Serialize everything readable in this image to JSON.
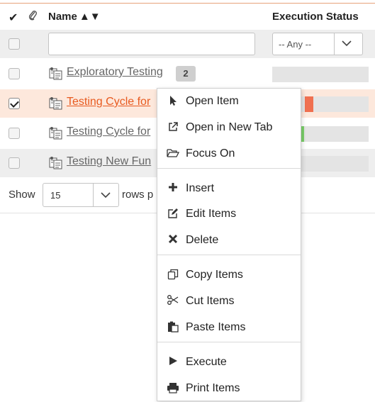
{
  "grid": {
    "columns": {
      "check_icon": "✔",
      "attachment_icon": "✎",
      "name": "Name",
      "sort_icon": "▲▼",
      "status": "Execution Status"
    },
    "filter": {
      "name_value": "",
      "status_value": "-- Any --"
    },
    "rows": [
      {
        "name": "Exploratory Testing",
        "badge": "2",
        "checked": false
      },
      {
        "name": "Testing Cycle for",
        "checked": true
      },
      {
        "name": "Testing Cycle for",
        "checked": false
      },
      {
        "name": "Testing New Fun",
        "checked": false
      }
    ]
  },
  "pager": {
    "show_label": "Show",
    "rows_value": "15",
    "suffix": "rows p"
  },
  "context_menu": {
    "items": [
      {
        "label": "Open Item",
        "icon": "cursor-arrow-icon"
      },
      {
        "label": "Open in New Tab",
        "icon": "external-link-icon"
      },
      {
        "label": "Focus On",
        "icon": "folder-open-icon"
      },
      {
        "label": "Insert",
        "icon": "plus-icon"
      },
      {
        "label": "Edit Items",
        "icon": "edit-icon"
      },
      {
        "label": "Delete",
        "icon": "delete-x-icon"
      },
      {
        "label": "Copy Items",
        "icon": "copy-icon"
      },
      {
        "label": "Cut Items",
        "icon": "scissors-icon"
      },
      {
        "label": "Paste Items",
        "icon": "paste-icon"
      },
      {
        "label": "Execute",
        "icon": "play-icon"
      },
      {
        "label": "Print Items",
        "icon": "print-icon"
      }
    ]
  },
  "colors": {
    "accent": "#e85a1f",
    "selected_row": "#fde8dc",
    "status_failed": "#f07050",
    "status_passed": "#7bd06a"
  }
}
